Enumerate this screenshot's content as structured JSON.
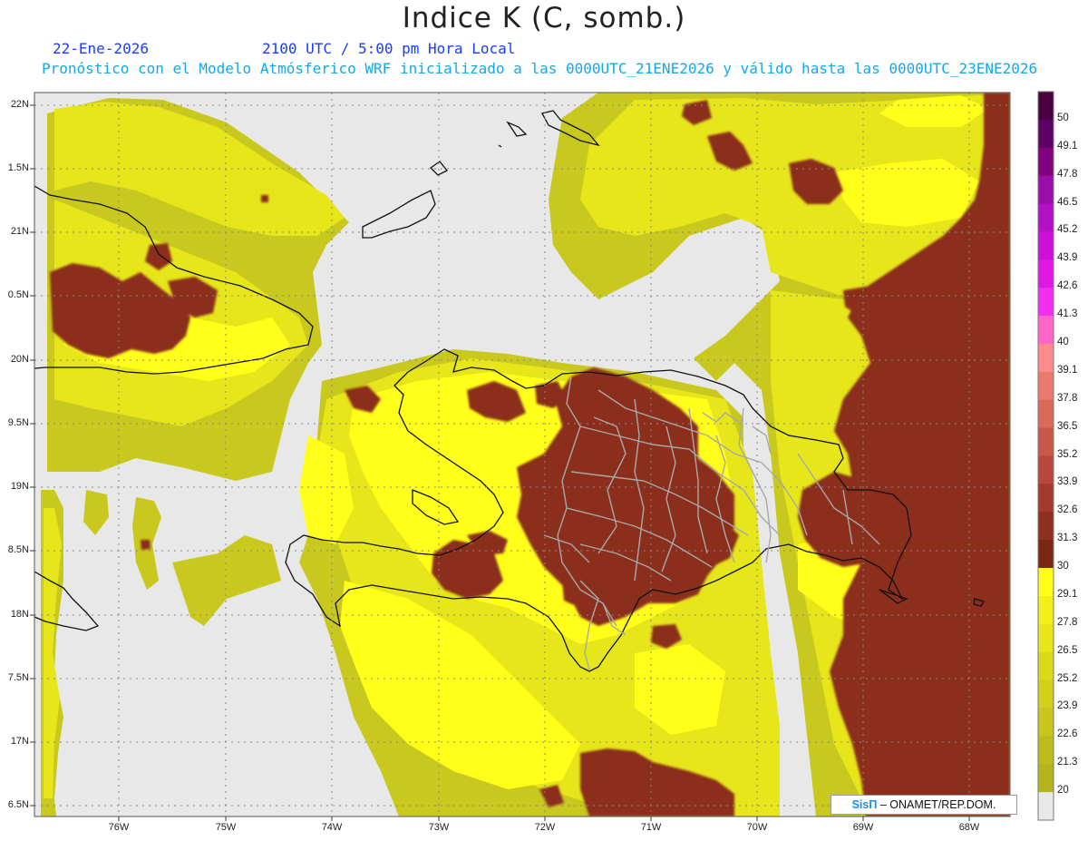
{
  "title": "Indice K (C, somb.)",
  "subtitle": {
    "date": "22-Ene-2026",
    "time": "2100 UTC / 5:00 pm Hora Local",
    "forecast": "Pronóstico con el Modelo Atmósferico WRF inicializado a las 0000UTC_21ENE2026 y válido hasta las  0000UTC_23ENE2026"
  },
  "credit": {
    "logo": "SisΠ",
    "text": " – ONAMET/REP.DOM."
  },
  "axes": {
    "lat_labels": [
      "22N",
      "1.5N",
      "21N",
      "0.5N",
      "20N",
      "9.5N",
      "19N",
      "8.5N",
      "18N",
      "7.5N",
      "17N",
      "6.5N"
    ],
    "lon_labels": [
      "76W",
      "75W",
      "74W",
      "73W",
      "72W",
      "71W",
      "70W",
      "69W",
      "68W"
    ]
  },
  "colorbar": {
    "labels": [
      "50",
      "49.1",
      "47.8",
      "46.5",
      "45.2",
      "43.9",
      "42.6",
      "41.3",
      "40",
      "39.1",
      "37.8",
      "36.5",
      "35.2",
      "33.9",
      "32.6",
      "31.3",
      "30",
      "29.1",
      "27.8",
      "26.5",
      "25.2",
      "23.9",
      "22.6",
      "21.3",
      "20"
    ],
    "colors": [
      "#4a0040",
      "#5c0066",
      "#800080",
      "#9b0da8",
      "#b410c8",
      "#cc10d8",
      "#e018e6",
      "#f030f0",
      "#ff66cc",
      "#ff8c8c",
      "#e87a6e",
      "#d96a5a",
      "#c8584a",
      "#b8483c",
      "#a43a2e",
      "#8e3020",
      "#7a2812",
      "#ffff1a",
      "#f0f01a",
      "#e6e61a",
      "#dada1c",
      "#d0d01e",
      "#c6c61e",
      "#bcbc1e",
      "#b4b41e",
      "#e8e8e8"
    ]
  },
  "colors": {
    "no_data": "#e8e8e8",
    "k_low": "#c8c81e",
    "k_mid": "#e6e61a",
    "k_high": "#ffff1a",
    "k_30_plus": "#8b2f1e",
    "coast": "#111111",
    "province_borders": "#a8a8a8",
    "grid": "#888888",
    "title_blue": "#1a3cff",
    "subtitle_cyan": "#15a8e8"
  }
}
